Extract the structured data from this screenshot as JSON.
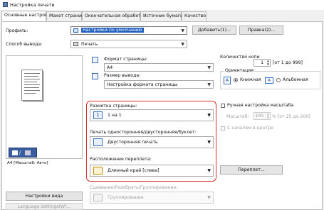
{
  "window": {
    "title": "Настройка печати"
  },
  "tabs": [
    {
      "label": "Основные настройки",
      "active": true
    },
    {
      "label": "Макет страницы"
    },
    {
      "label": "Окончательная обработка"
    },
    {
      "label": "Источник бумаги"
    },
    {
      "label": "Качество"
    }
  ],
  "profile": {
    "label": "Профиль:",
    "value": "Настройки по умолчанию",
    "add_button": "Добавить(1)...",
    "edit_button": "Правка(2)..."
  },
  "output": {
    "label": "Способ вывода:",
    "value": "Печать"
  },
  "preview": {
    "caption": "A4 [Масштаб: Авто]",
    "view_settings_button": "Настройки вида",
    "language_button": "Language Settings(W)..."
  },
  "page_size": {
    "label": "Формат страницы:",
    "value": "A4"
  },
  "output_size": {
    "label": "Размер вывода:",
    "value": "Настройка формата страницы"
  },
  "copies": {
    "label": "Количество копи",
    "value": "1",
    "range": "[от 1 до 999]"
  },
  "orientation": {
    "label": "Ориентация",
    "portrait": "Книжная",
    "landscape": "Альбомная",
    "icon_letter": "A"
  },
  "layout": {
    "label": "Разметка страницы:",
    "value": "1 на 1",
    "icon_text": "1"
  },
  "duplex": {
    "label": "Печать односторонняя/двусторонняя/буклет:",
    "value": "Двусторонняя печать"
  },
  "binding": {
    "label": "Расположение переплета:",
    "value": "Длинный край [слева]",
    "button": "Переплет..."
  },
  "scaling": {
    "checkbox": "Ручная настройка масштаба",
    "label": "Масштаб:",
    "value": "100",
    "range": "% [от 25 до 200]",
    "center": "С началом в центре"
  },
  "collate": {
    "label": "Сшивание/Разобрать/Группирование:",
    "value": "Группирование"
  },
  "colors": {
    "accent": "#d9312b",
    "selection": "#1f5fbf"
  }
}
